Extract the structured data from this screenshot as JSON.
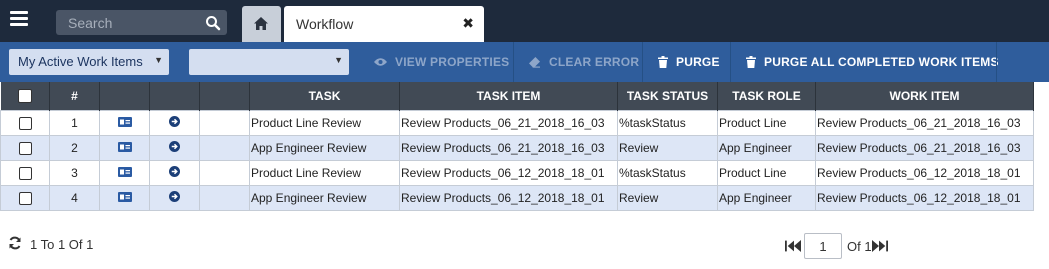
{
  "header": {
    "search_placeholder": "Search",
    "active_tab": "Workflow",
    "close_glyph": "✖"
  },
  "toolbar": {
    "filter_select": "My Active Work Items",
    "secondary_select": "",
    "view_properties": "VIEW PROPERTIES",
    "clear_error": "CLEAR ERROR",
    "purge": "PURGE",
    "purge_all": "PURGE ALL COMPLETED WORK ITEMS"
  },
  "table": {
    "columns": [
      "#",
      "TASK",
      "TASK ITEM",
      "TASK STATUS",
      "TASK ROLE",
      "WORK ITEM"
    ],
    "rows": [
      {
        "num": "1",
        "task": "Product Line Review",
        "task_item": "Review Products_06_21_2018_16_03",
        "status": "%taskStatus",
        "role": "Product Line",
        "work_item": "Review Products_06_21_2018_16_03"
      },
      {
        "num": "2",
        "task": "App Engineer Review",
        "task_item": "Review Products_06_21_2018_16_03",
        "status": "Review",
        "role": "App Engineer",
        "work_item": "Review Products_06_21_2018_16_03"
      },
      {
        "num": "3",
        "task": "Product Line Review",
        "task_item": "Review Products_06_12_2018_18_01",
        "status": "%taskStatus",
        "role": "Product Line",
        "work_item": "Review Products_06_12_2018_18_01"
      },
      {
        "num": "4",
        "task": "App Engineer Review",
        "task_item": "Review Products_06_12_2018_18_01",
        "status": "Review",
        "role": "App Engineer",
        "work_item": "Review Products_06_12_2018_18_01"
      }
    ]
  },
  "footer": {
    "range_text": "1 To 1 Of 1",
    "page_value": "1",
    "of_text": "Of 1"
  },
  "colors": {
    "topbar": "#1e2a3c",
    "toolbar": "#2f5d9c",
    "header_row": "#414a55",
    "alt_row": "#dde6f6",
    "icon_blue": "#2a5aa3"
  }
}
